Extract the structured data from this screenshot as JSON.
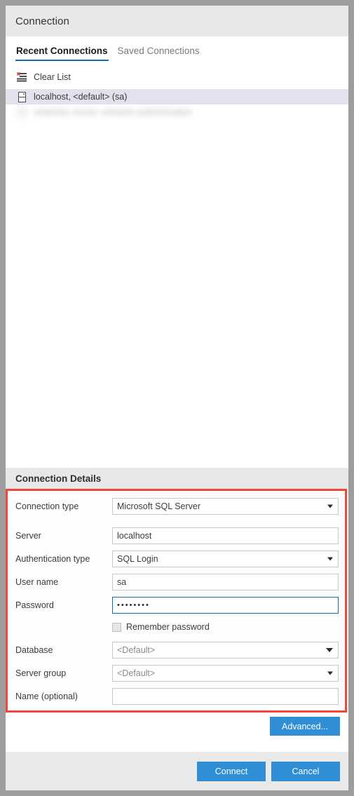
{
  "window": {
    "title": "Connection"
  },
  "tabs": [
    {
      "label": "Recent Connections",
      "active": true
    },
    {
      "label": "Saved Connections",
      "active": false
    }
  ],
  "recent_list": {
    "clear_label": "Clear List",
    "clear_icon": "clear-list-icon",
    "items": [
      {
        "label": "localhost, <default> (sa)",
        "icon": "server-icon",
        "selected": true,
        "redacted": false
      },
      {
        "label": "redacted, server, windows authentication",
        "icon": "server-icon",
        "selected": false,
        "redacted": true
      }
    ]
  },
  "details": {
    "header": "Connection Details",
    "highlight_color": "#f4443c",
    "fields": {
      "connection_type": {
        "label": "Connection type",
        "value": "Microsoft SQL Server",
        "type": "dropdown"
      },
      "server": {
        "label": "Server",
        "value": "localhost",
        "placeholder": "",
        "type": "text"
      },
      "authentication_type": {
        "label": "Authentication type",
        "value": "SQL Login",
        "type": "dropdown"
      },
      "user_name": {
        "label": "User name",
        "value": "sa",
        "placeholder": "",
        "type": "text"
      },
      "password": {
        "label": "Password",
        "value": "••••••••",
        "type": "password",
        "focused": true
      },
      "remember_password": {
        "label": "Remember password",
        "checked": false
      },
      "database": {
        "label": "Database",
        "value": "<Default>",
        "type": "dropdown",
        "muted": true
      },
      "server_group": {
        "label": "Server group",
        "value": "<Default>",
        "type": "dropdown",
        "muted": true
      },
      "name_optional": {
        "label": "Name (optional)",
        "value": "",
        "placeholder": "",
        "type": "text"
      }
    }
  },
  "buttons": {
    "advanced": "Advanced...",
    "connect": "Connect",
    "cancel": "Cancel",
    "accent_color": "#2f8ed6"
  }
}
